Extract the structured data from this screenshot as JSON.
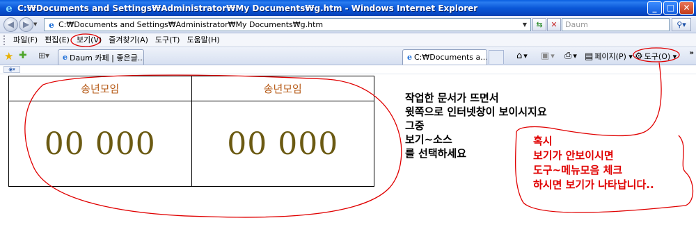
{
  "window": {
    "title": "C:₩Documents and Settings₩Administrator₩My Documents₩g.htm - Windows Internet Explorer",
    "minimize_label": "_",
    "maximize_label": "□",
    "close_label": "✕"
  },
  "address_bar": {
    "url": "C:₩Documents and Settings₩Administrator₩My Documents₩g.htm",
    "search_placeholder": "Daum"
  },
  "menu": {
    "items": [
      "파일(F)",
      "편집(E)",
      "보기(V)",
      "즐겨찾기(A)",
      "도구(T)",
      "도움말(H)"
    ]
  },
  "tabs": [
    {
      "label": "Daum 카페 | 좋은글..."
    },
    {
      "label": "C:₩Documents a..."
    }
  ],
  "command_bar": {
    "page_label": "페이지(P)",
    "tools_label": "도구(O)"
  },
  "content": {
    "table": {
      "headers": [
        "송년모임",
        "송년모임"
      ],
      "values": [
        "00 000",
        "00 000"
      ]
    },
    "instructions": [
      "작업한 문서가 뜨면서",
      "윗쪽으로 인터넷창이 보이시지요",
      "그중",
      "보기~소스",
      "를 선택하세요"
    ],
    "red_note": [
      "혹시",
      "보기가 안보이시면",
      "도구~메뉴모음 체크",
      "하시면 보기가 나타납니다.."
    ]
  },
  "colors": {
    "titlebar": "#0b58d8",
    "header_text": "#b65a16",
    "number_text": "#6b5a12",
    "annotation_red": "#e00000"
  }
}
